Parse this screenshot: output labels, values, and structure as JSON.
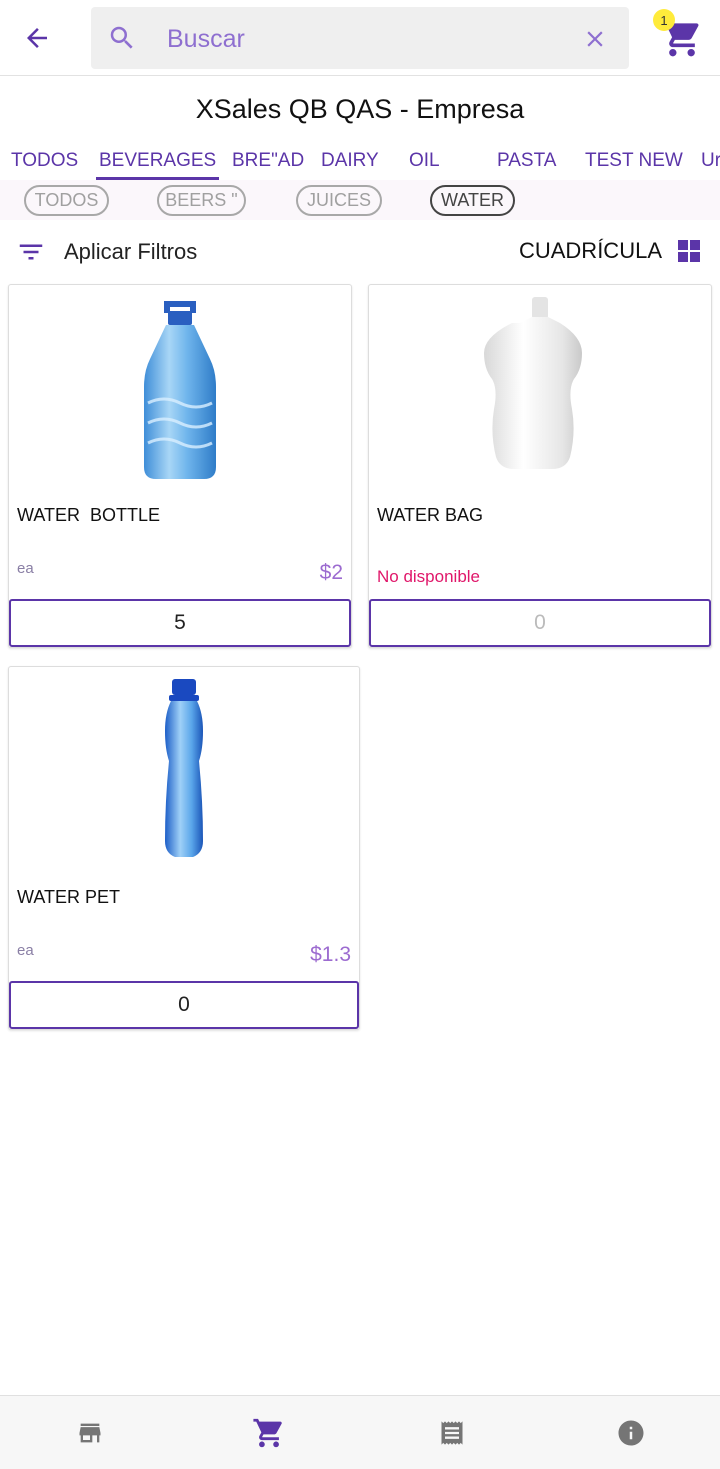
{
  "search": {
    "placeholder": "Buscar"
  },
  "cart": {
    "badge_count": "1"
  },
  "company": {
    "title": "XSales QB QAS - Empresa"
  },
  "categories": [
    {
      "label": "TODOS"
    },
    {
      "label": "BEVERAGES"
    },
    {
      "label": "BRE\"AD"
    },
    {
      "label": "DAIRY"
    },
    {
      "label": "OIL"
    },
    {
      "label": "PASTA"
    },
    {
      "label": "TEST NEW"
    },
    {
      "label": "Ur"
    }
  ],
  "active_category": "BEVERAGES",
  "subcategories": [
    {
      "label": "TODOS"
    },
    {
      "label": "BEERS \""
    },
    {
      "label": "JUICES"
    },
    {
      "label": "WATER"
    }
  ],
  "active_subcategory": "WATER",
  "filters": {
    "label": "Aplicar Filtros"
  },
  "view": {
    "label": "CUADRÍCULA"
  },
  "products": [
    {
      "name": "WATER  BOTTLE",
      "unit": "ea",
      "price": "$2",
      "quantity": "5",
      "available": true,
      "image": "water-jug-image"
    },
    {
      "name": "WATER BAG",
      "unit": "",
      "status": "No disponible",
      "quantity": "0",
      "available": false,
      "image": "water-pouch-image"
    },
    {
      "name": "WATER PET",
      "unit": "ea",
      "price": "$1.3",
      "quantity": "0",
      "available": true,
      "image": "water-pet-bottle-image"
    }
  ],
  "colors": {
    "accent": "#5b35a8",
    "price": "#9c6bd0",
    "unavailable": "#e0176a",
    "badge": "#ffeb3b"
  },
  "bottom_nav": [
    {
      "icon": "store-icon"
    },
    {
      "icon": "cart-icon",
      "active": true
    },
    {
      "icon": "receipt-icon"
    },
    {
      "icon": "info-icon"
    }
  ]
}
